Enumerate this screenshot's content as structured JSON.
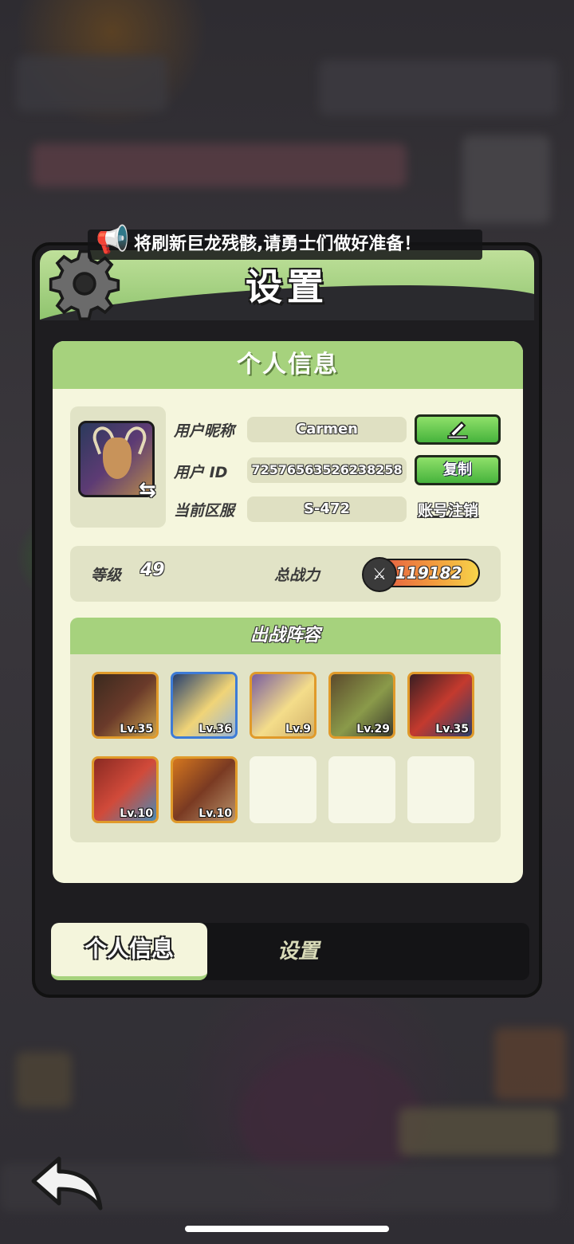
{
  "ticker": {
    "text": "将刷新巨龙残骸,请勇士们做好准备！"
  },
  "panel": {
    "title": "设置"
  },
  "profile": {
    "section_title": "个人信息",
    "nickname_label": "用户昵称",
    "nickname": "Carmen",
    "id_label": "用户  ID",
    "id": "72576563526238258",
    "server_label": "当前区服",
    "server": "S-472",
    "copy_label": "复制",
    "cancel_account_label": "账号注销",
    "edit_icon": "pencil-icon",
    "swap_icon": "swap-arrows-icon"
  },
  "stats": {
    "level_label": "等级",
    "level": "49",
    "power_label": "总战力",
    "power": "119182"
  },
  "lineup": {
    "title": "出战阵容",
    "heroes": [
      {
        "level": "Lv.35",
        "frame": "#e09a2a"
      },
      {
        "level": "Lv.36",
        "frame": "#3d7bd6"
      },
      {
        "level": "Lv.9",
        "frame": "#e09a2a"
      },
      {
        "level": "Lv.29",
        "frame": "#e09a2a"
      },
      {
        "level": "Lv.35",
        "frame": "#e09a2a"
      },
      {
        "level": "Lv.10",
        "frame": "#e09a2a"
      },
      {
        "level": "Lv.10",
        "frame": "#e09a2a"
      }
    ],
    "empty_slots": 3
  },
  "tabs": {
    "active": "个人信息",
    "inactive": "设置"
  },
  "colors": {
    "accent_green": "#a6d27d",
    "card_bg": "#f5f6dd",
    "button_green": "#46b33c"
  }
}
